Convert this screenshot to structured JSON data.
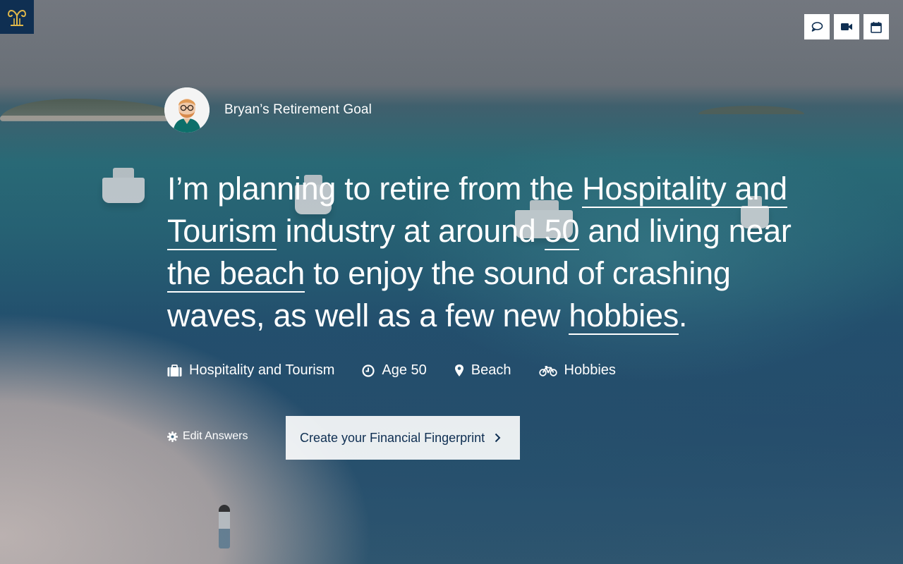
{
  "brand": {
    "logo_icon": "capital-logo-icon",
    "color": "#0f2f52"
  },
  "top_actions": [
    {
      "icon": "chat-icon",
      "label": "Chat"
    },
    {
      "icon": "video-icon",
      "label": "Video"
    },
    {
      "icon": "calendar-icon",
      "label": "Calendar"
    }
  ],
  "profile": {
    "goal_title": "Bryan’s Retirement Goal",
    "avatar_icon": "bryan-avatar"
  },
  "statement": {
    "p1": "I’m planning to retire from the ",
    "industry": "Hospitality and Tourism",
    "p2": " industry at around ",
    "age": "50",
    "p3": " and living near ",
    "location": "the beach",
    "p4": " to enjoy the sound of crashing waves, as well as a few new ",
    "activity": "hobbies",
    "p5": "."
  },
  "tags": [
    {
      "icon": "briefcase-icon",
      "label": "Hospitality and Tourism"
    },
    {
      "icon": "clock-icon",
      "label": "Age 50"
    },
    {
      "icon": "map-pin-icon",
      "label": "Beach"
    },
    {
      "icon": "bicycle-icon",
      "label": "Hobbies"
    }
  ],
  "actions": {
    "edit_label": "Edit Answers",
    "cta_label": "Create your Financial Fingerprint"
  }
}
